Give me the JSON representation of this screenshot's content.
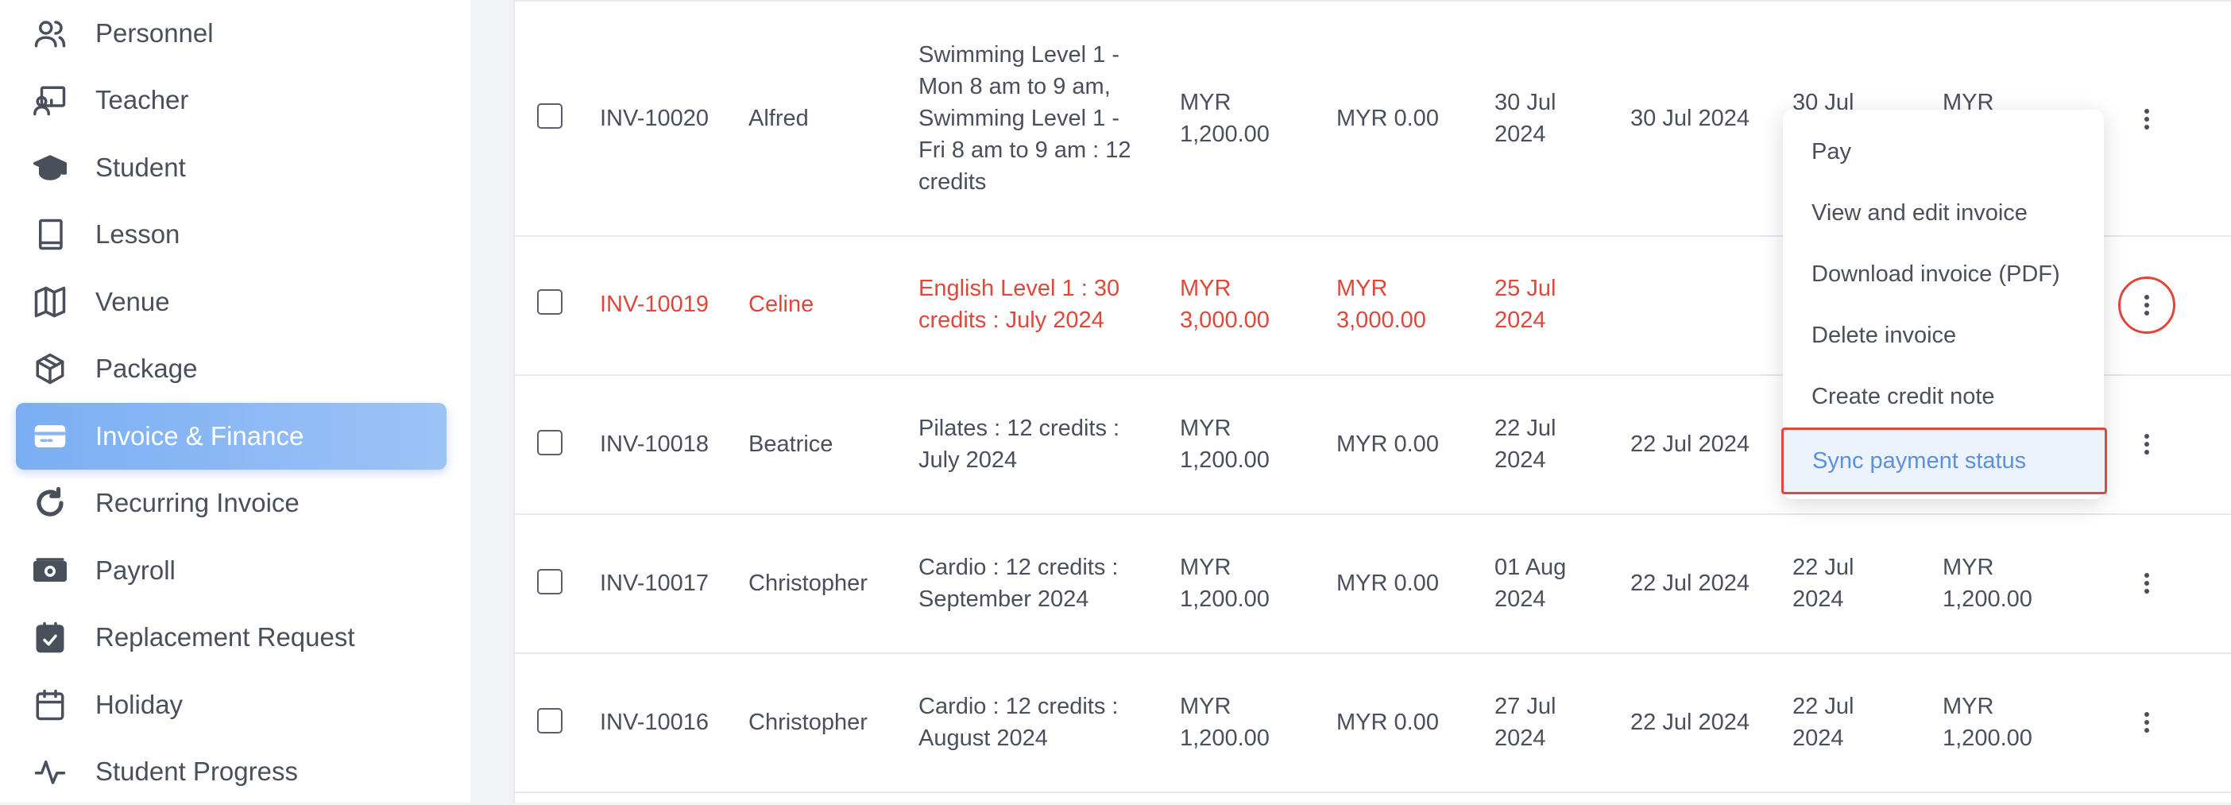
{
  "sidebar": {
    "items": [
      {
        "label": "Personnel",
        "icon": "users-icon"
      },
      {
        "label": "Teacher",
        "icon": "teacher-icon"
      },
      {
        "label": "Student",
        "icon": "graduation-cap-icon"
      },
      {
        "label": "Lesson",
        "icon": "book-icon"
      },
      {
        "label": "Venue",
        "icon": "map-icon"
      },
      {
        "label": "Package",
        "icon": "package-icon"
      },
      {
        "label": "Invoice & Finance",
        "icon": "credit-card-icon",
        "active": true
      },
      {
        "label": "Recurring Invoice",
        "icon": "refresh-icon"
      },
      {
        "label": "Payroll",
        "icon": "money-icon"
      },
      {
        "label": "Replacement Request",
        "icon": "calendar-check-icon"
      },
      {
        "label": "Holiday",
        "icon": "calendar-icon"
      },
      {
        "label": "Student Progress",
        "icon": "activity-icon"
      }
    ]
  },
  "table": {
    "rows": [
      {
        "invoice": "INV-10020",
        "name": "Alfred",
        "desc": [
          "Swimming Level 1 -",
          "Mon 8 am to 9 am,",
          "Swimming Level 1 -",
          "Fri 8 am to 9 am : 12",
          "credits"
        ],
        "amount": [
          "MYR",
          "1,200.00"
        ],
        "paid": "MYR 0.00",
        "due": [
          "30 Jul",
          "2024"
        ],
        "issued": "30 Jul 2024",
        "date2": [
          "30 Jul",
          ""
        ],
        "total": [
          "MYR",
          ""
        ],
        "overdue": false
      },
      {
        "invoice": "INV-10019",
        "name": "Celine",
        "desc": [
          "English Level 1 : 30",
          "credits : July 2024"
        ],
        "amount": [
          "MYR",
          "3,000.00"
        ],
        "paid": [
          "MYR",
          "3,000.00"
        ],
        "due": [
          "25 Jul",
          "2024"
        ],
        "overdue": true
      },
      {
        "invoice": "INV-10018",
        "name": "Beatrice",
        "desc": [
          "Pilates : 12 credits :",
          "July 2024"
        ],
        "amount": [
          "MYR",
          "1,200.00"
        ],
        "paid": "MYR 0.00",
        "due": [
          "22 Jul",
          "2024"
        ],
        "issued": "22 Jul 2024",
        "overdue": false
      },
      {
        "invoice": "INV-10017",
        "name": "Christopher",
        "desc": [
          "Cardio : 12 credits :",
          "September 2024"
        ],
        "amount": [
          "MYR",
          "1,200.00"
        ],
        "paid": "MYR 0.00",
        "due": [
          "01 Aug",
          "2024"
        ],
        "issued": "22 Jul 2024",
        "date2": [
          "22 Jul",
          "2024"
        ],
        "total": [
          "MYR",
          "1,200.00"
        ],
        "overdue": false
      },
      {
        "invoice": "INV-10016",
        "name": "Christopher",
        "desc": [
          "Cardio : 12 credits :",
          "August 2024"
        ],
        "amount": [
          "MYR",
          "1,200.00"
        ],
        "paid": "MYR 0.00",
        "due": [
          "27 Jul",
          "2024"
        ],
        "issued": "22 Jul 2024",
        "date2": [
          "22 Jul",
          "2024"
        ],
        "total": [
          "MYR",
          "1,200.00"
        ],
        "overdue": false
      }
    ]
  },
  "menu": {
    "items": [
      "Pay",
      "View and edit invoice",
      "Download invoice (PDF)",
      "Delete invoice",
      "Create credit note",
      "Sync payment status"
    ]
  },
  "colors": {
    "overdue": "#e0473b",
    "accent": "#7aaef3",
    "highlight_border": "#e0473b"
  }
}
